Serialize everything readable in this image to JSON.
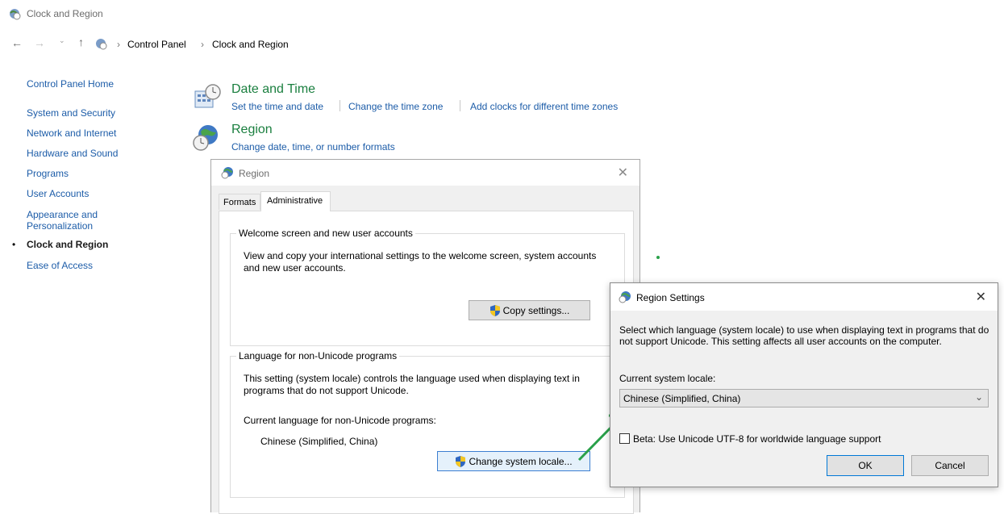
{
  "window": {
    "title": "Clock and Region"
  },
  "breadcrumb": {
    "items": [
      "Control Panel",
      "Clock and Region"
    ]
  },
  "sidebar": {
    "items": [
      {
        "label": "Control Panel Home"
      },
      {
        "label": "System and Security"
      },
      {
        "label": "Network and Internet"
      },
      {
        "label": "Hardware and Sound"
      },
      {
        "label": "Programs"
      },
      {
        "label": "User Accounts"
      },
      {
        "label": "Appearance and Personalization"
      },
      {
        "label": "Clock and Region",
        "active": true
      },
      {
        "label": "Ease of Access"
      }
    ]
  },
  "date_time": {
    "title": "Date and Time",
    "links": [
      "Set the time and date",
      "Change the time zone",
      "Add clocks for different time zones"
    ]
  },
  "region": {
    "title": "Region",
    "link": "Change date, time, or number formats"
  },
  "region_dialog": {
    "title": "Region",
    "tabs": [
      "Formats",
      "Administrative"
    ],
    "active_tab": "Administrative",
    "welcome": {
      "label": "Welcome screen and new user accounts",
      "text": "View and copy your international settings to the welcome screen, system accounts and new user accounts.",
      "button": "Copy settings..."
    },
    "nonunicode": {
      "label": "Language for non-Unicode programs",
      "text": "This setting (system locale) controls the language used when displaying text in programs that do not support Unicode.",
      "current_label": "Current language for non-Unicode programs:",
      "current_value": "Chinese (Simplified, China)",
      "button": "Change system locale..."
    }
  },
  "settings_dialog": {
    "title": "Region Settings",
    "description": "Select which language (system locale) to use when displaying text in programs that do not support Unicode. This setting affects all user accounts on the computer.",
    "locale_label": "Current system locale:",
    "locale_value": "Chinese (Simplified, China)",
    "beta_label": "Beta: Use Unicode UTF-8 for worldwide language support",
    "beta_checked": false,
    "ok": "OK",
    "cancel": "Cancel"
  },
  "colors": {
    "link": "#1c5ca8",
    "category": "#1a7f3f",
    "arrow": "#2aa14a"
  },
  "icons": {
    "window": "region-globe-icon",
    "date_time": "calendar-clock-icon",
    "region": "globe-clock-icon",
    "shield": "uac-shield-icon"
  }
}
